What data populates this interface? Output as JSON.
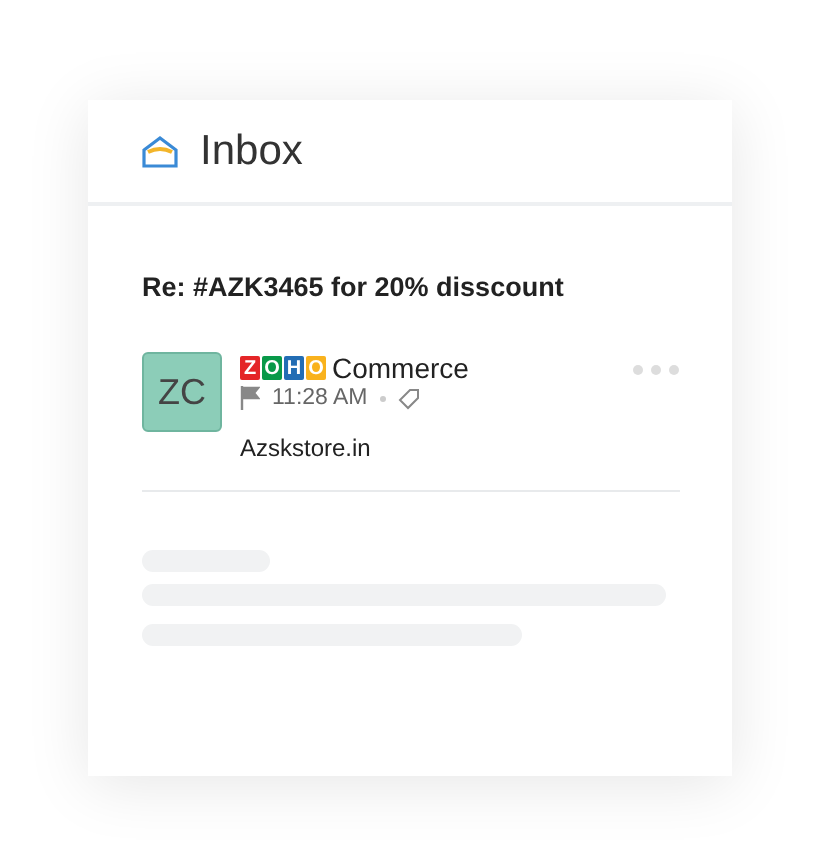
{
  "header": {
    "title": "Inbox"
  },
  "message": {
    "subject": "Re: #AZK3465 for 20% disscount",
    "avatar": "ZC",
    "logo_letters": [
      {
        "letter": "Z",
        "color": "#e42527"
      },
      {
        "letter": "O",
        "color": "#089949"
      },
      {
        "letter": "H",
        "color": "#226db4"
      },
      {
        "letter": "O",
        "color": "#f9b21d"
      }
    ],
    "sender": "Commerce",
    "time": "11:28 AM",
    "body": "Azskstore.in"
  }
}
